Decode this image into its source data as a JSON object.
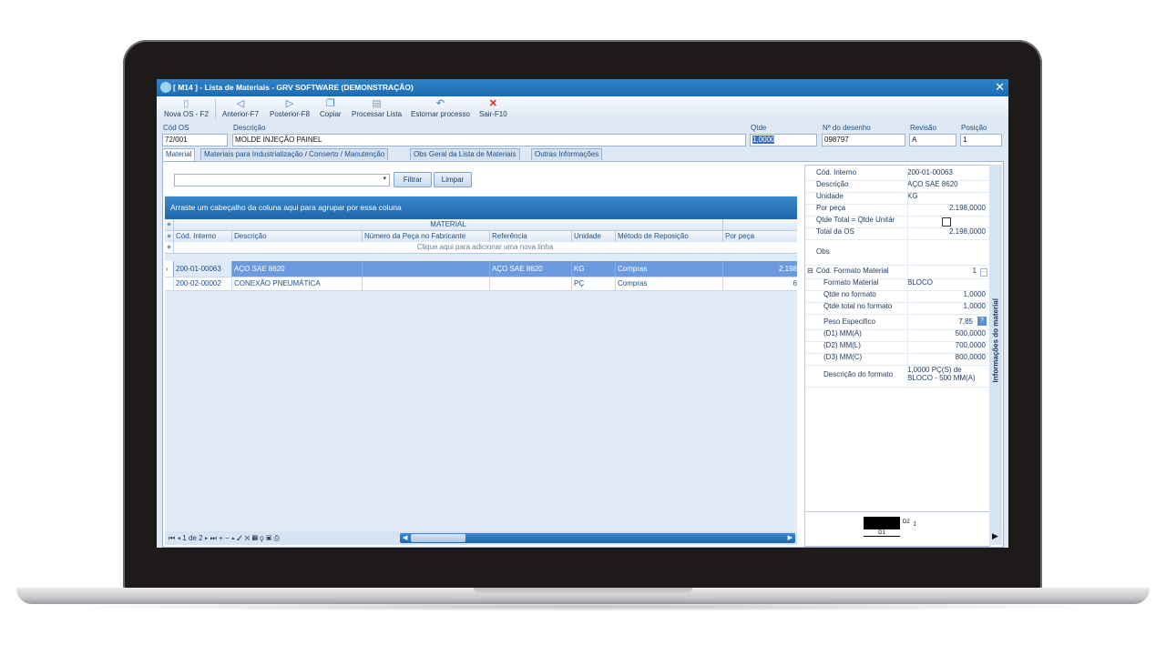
{
  "window": {
    "title": "[ M14 ] - Lista de Materiais - GRV SOFTWARE (DEMONSTRAÇÃO)",
    "close_glyph": "✕"
  },
  "toolbar": {
    "items": [
      {
        "label": "Nova OS - F2",
        "icon": "new-document-icon"
      },
      {
        "label": "Anterior-F7",
        "icon": "arrow-left-icon"
      },
      {
        "label": "Posterior-F8",
        "icon": "arrow-right-icon"
      },
      {
        "label": "Copiar",
        "icon": "copy-icon"
      },
      {
        "label": "Processar Lista",
        "icon": "process-icon"
      },
      {
        "label": "Estornar processo",
        "icon": "undo-icon"
      },
      {
        "label": "Sair-F10",
        "icon": "close-icon"
      }
    ]
  },
  "header": {
    "cod_os_label": "Cód OS",
    "cod_os_value": "72/001",
    "descricao_label": "Descrição",
    "descricao_value": "MOLDE INJEÇÃO PAINEL",
    "qtde_label": "Qtde",
    "qtde_value": "1,0000",
    "desenho_label": "Nº do desenho",
    "desenho_value": "098797",
    "revisao_label": "Revisão",
    "revisao_value": "A",
    "posicao_label": "Posição",
    "posicao_value": "1"
  },
  "tabs": [
    {
      "label": "Material",
      "active": true
    },
    {
      "label": "Materiais para Industrialização / Conserto / Manutenção"
    },
    {
      "label": "Obs Geral da Lista de Materiais"
    },
    {
      "label": "Outras Informações"
    }
  ],
  "filter": {
    "filtrar_label": "Filtrar",
    "limpar_label": "Limpar"
  },
  "grid": {
    "group_hint": "Arraste um cabeçalho da coluna aqui para agrupar por essa coluna",
    "band_title": "MATERIAL",
    "columns": [
      "Cód. Interno",
      "Descrição",
      "Número da Peça no Fabricante",
      "Referência",
      "Unidade",
      "Método de Reposição",
      "Por peça"
    ],
    "new_row_hint": "Clique aqui para adicionar uma nova linha",
    "rows": [
      [
        "200-01-00063",
        "AÇO SAE 8620",
        "",
        "AÇO SAE 8620",
        "KG",
        "Compras",
        "2.198"
      ],
      [
        "200-02-00002",
        "CONEXÃO PNEUMÁTICA",
        "",
        "",
        "PÇ",
        "Compras",
        "6"
      ]
    ],
    "selected_marker": "›",
    "pager_text": "1 de 2"
  },
  "properties": {
    "rows": [
      {
        "k": "Cód. Interno",
        "v": "200-01-00063"
      },
      {
        "k": "Descrição",
        "v": "AÇO SAE  8620"
      },
      {
        "k": "Unidade",
        "v": "KG"
      },
      {
        "k": "Por peça",
        "v": "2.198,0000"
      },
      {
        "k": "Qtde Total = Qtde Unitár",
        "v": ""
      },
      {
        "k": "Total da OS",
        "v": "2.198,0000"
      },
      {
        "k": "Obs",
        "v": ""
      },
      {
        "k": "Cód. Formato Material",
        "v": "1"
      },
      {
        "k": "Formato Material",
        "v": "BLOCO"
      },
      {
        "k": "Qtde no formato",
        "v": "1,0000"
      },
      {
        "k": "Qtde total no formato",
        "v": "1,0000"
      },
      {
        "k": "Peso Especifico",
        "v": "7,85"
      },
      {
        "k": "(D1) MM(A)",
        "v": "500,0000"
      },
      {
        "k": "(D2) MM(L)",
        "v": "700,0000"
      },
      {
        "k": "(D3) MM(C)",
        "v": "800,0000"
      },
      {
        "k": "Descrição do formato",
        "v": "1,0000 PÇ(S) de BLOCO - 500 MM(A)"
      }
    ],
    "diagram_d1": "D1",
    "diagram_d2": "D2",
    "side_title": "Informações do material"
  },
  "colors": {
    "accent": "#1f66ad",
    "selection": "#6c9ae0"
  }
}
